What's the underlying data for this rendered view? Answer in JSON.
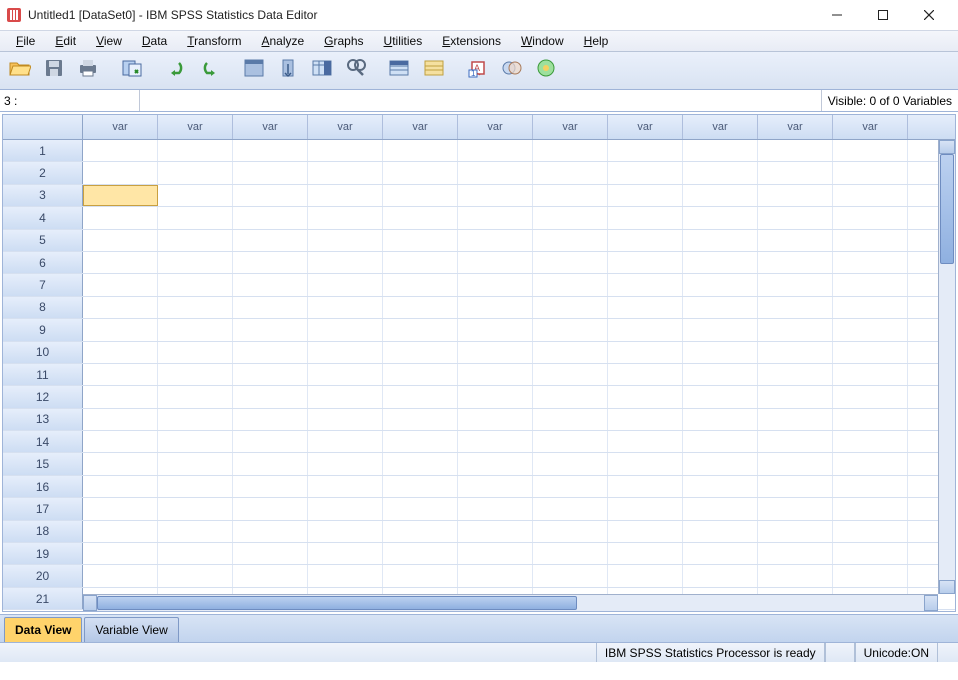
{
  "title": "Untitled1 [DataSet0] - IBM SPSS Statistics Data Editor",
  "menus": [
    "File",
    "Edit",
    "View",
    "Data",
    "Transform",
    "Analyze",
    "Graphs",
    "Utilities",
    "Extensions",
    "Window",
    "Help"
  ],
  "toolbar_icons": [
    "open-file-icon",
    "save-icon",
    "print-icon",
    "recall-dialog-icon",
    "undo-icon",
    "redo-icon",
    "goto-case-icon",
    "goto-variable-icon",
    "variables-icon",
    "find-icon",
    "insert-case-icon",
    "split-file-icon",
    "weight-cases-icon",
    "select-cases-icon",
    "value-labels-icon",
    "use-sets-icon",
    "customize-icon"
  ],
  "cell_ref": "3 :",
  "visible_label": "Visible: 0 of 0 Variables",
  "column_header_label": "var",
  "num_columns": 11,
  "num_rows": 21,
  "selected_row": 3,
  "selected_col": 1,
  "tabs": {
    "data_view": "Data View",
    "variable_view": "Variable View",
    "active": "data_view"
  },
  "status": {
    "processor": "IBM SPSS Statistics Processor is ready",
    "unicode": "Unicode:ON"
  }
}
